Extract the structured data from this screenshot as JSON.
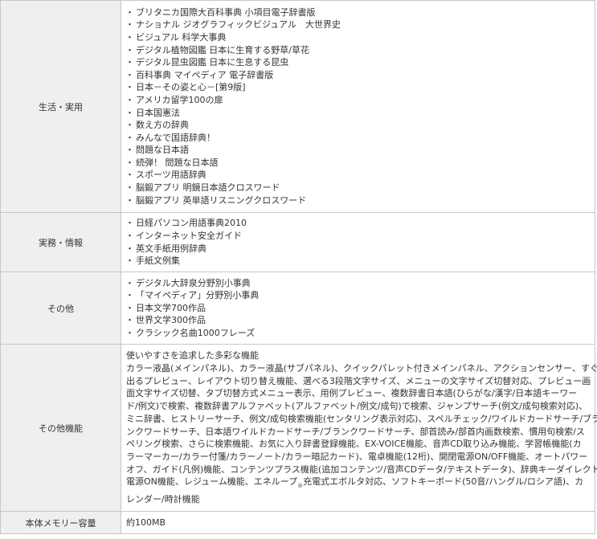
{
  "rows": {
    "life": {
      "label": "生活・実用",
      "items": [
        "ブリタニカ国際大百科事典 小項目電子辞書版",
        "ナショナル ジオグラフィックビジュアル　大世界史",
        "ビジュアル 科学大事典",
        "デジタル植物図鑑 日本に生育する野草/草花",
        "デジタル昆虫図鑑 日本に生息する昆虫",
        "百科事典 マイペディア 電子辞書版",
        "日本－その姿と心－[第9版]",
        "アメリカ留学100の扉",
        "日本国憲法",
        "数え方の辞典",
        "みんなで国語辞典！",
        "問題な日本語",
        "続弾！ 問題な日本語",
        "スポーツ用語辞典",
        "脳鍛アプリ 明鏡日本語クロスワード",
        "脳鍛アプリ 英単語リスニングクロスワード"
      ]
    },
    "business": {
      "label": "実務・情報",
      "items": [
        "日経パソコン用語事典2010",
        "インターネット安全ガイド",
        "英文手紙用例辞典",
        "手紙文例集"
      ]
    },
    "other": {
      "label": "その他",
      "items": [
        "デジタル大辞泉分野別小事典",
        "「マイペディア」分野別小事典",
        "日本文学700作品",
        "世界文学300作品",
        "クラシック名曲1000フレーズ"
      ]
    },
    "features": {
      "label": "その他機能",
      "lines": [
        "使いやすさを追求した多彩な機能",
        "カラー液晶(メインパネル)、カラー液晶(サブパネル)、クイックパレット付きメインパネル、アクションセンサー、すぐ",
        "出るプレビュー、レイアウト切り替え機能、選べる3段階文字サイズ、メニューの文字サイズ切替対応、プレビュー画",
        "面文字サイズ切替、タブ切替方式メニュー表示、用例プレビュー、複数辞書日本語(ひらがな/漢字/日本語キーワー",
        "ド/例文)で検索、複数辞書アルファベット(アルファベット/例文/成句)で検索、ジャンプサーチ(例文/成句検索対応)、",
        "ミニ辞書、ヒストリーサーチ、例文/成句検索機能(センタリング表示対応)、スペルチェック/ワイルドカードサーチ/ブラ",
        "ンクワードサーチ、日本語ワイルドカードサーチ/ブランクワードサーチ、部首読み/部首内画数検索、慣用句検索/ス",
        "ペリング検索、さらに検索機能、お気に入り辞書登録機能、EX-VOICE機能、音声CD取り込み機能、学習帳機能(カ",
        "ラーマーカー/カラー付箋/カラーノート/カラー暗記カード)、電卓機能(12桁)、開閉電源ON/OFF機能、オートパワー",
        "オフ、ガイド(凡例)機能、コンテンツプラス機能(追加コンテンツ/音声CDデータ/テキストデータ)、辞典キーダイレクト"
      ],
      "line11_part1": "電源ON機能、レジューム機能、エネループ",
      "line11_mark": "®",
      "line11_part2": "充電式エボルタ対応、ソフトキーボード(50音/ハングル/ロシア語)、カ",
      "line12": "レンダー/時計機能"
    },
    "memory": {
      "label": "本体メモリー容量",
      "value": "約100MB"
    }
  }
}
